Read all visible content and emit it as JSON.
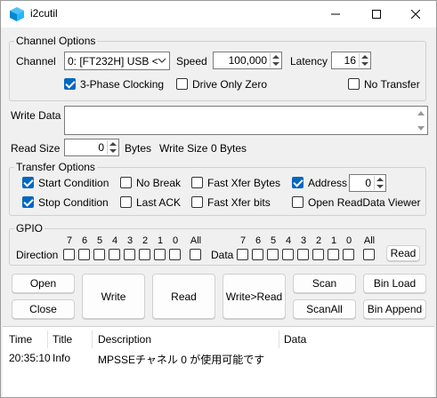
{
  "window": {
    "title": "i2cutil",
    "icon": "cube-icon"
  },
  "channel_options": {
    "group_title": "Channel Options",
    "channel_label": "Channel",
    "channel_value": "0: [FT232H] USB <",
    "speed_label": "Speed",
    "speed_value": "100,000",
    "latency_label": "Latency",
    "latency_value": "16",
    "three_phase_label": "3-Phase Clocking",
    "three_phase_checked": true,
    "drive_only_zero_label": "Drive Only Zero",
    "drive_only_zero_checked": false,
    "no_transfer_label": "No Transfer",
    "no_transfer_checked": false
  },
  "write_data": {
    "label": "Write Data",
    "value": ""
  },
  "sizes": {
    "read_size_label": "Read Size",
    "read_size_value": "0",
    "read_size_unit": "Bytes",
    "write_size_label": "Write Size",
    "write_size_value": "0 Bytes"
  },
  "transfer_options": {
    "group_title": "Transfer Options",
    "start_condition": "Start Condition",
    "no_break": "No Break",
    "fast_xfer_bytes": "Fast Xfer Bytes",
    "address": "Address",
    "address_value": "0",
    "stop_condition": "Stop Condition",
    "last_ack": "Last ACK",
    "fast_xfer_bits": "Fast Xfer bits",
    "open_readdata_viewer": "Open ReadData Viewer"
  },
  "gpio": {
    "group_title": "GPIO",
    "direction_label": "Direction",
    "data_label": "Data",
    "bits": [
      "7",
      "6",
      "5",
      "4",
      "3",
      "2",
      "1",
      "0"
    ],
    "all_label": "All",
    "read_button": "Read"
  },
  "buttons": {
    "open": "Open",
    "close": "Close",
    "write": "Write",
    "read": "Read",
    "write_read": "Write>Read",
    "scan": "Scan",
    "scan_all": "ScanAll",
    "bin_load": "Bin Load",
    "bin_append": "Bin Append"
  },
  "log": {
    "columns": [
      "Time",
      "Title",
      "Description",
      "Data"
    ],
    "rows": [
      {
        "time": "20:35:10",
        "title": "Info",
        "description": "MPSSEチャネル 0 が使用可能です",
        "data": ""
      }
    ]
  },
  "colors": {
    "accent": "#0067c0",
    "window_bg": "#f0f0f0"
  }
}
